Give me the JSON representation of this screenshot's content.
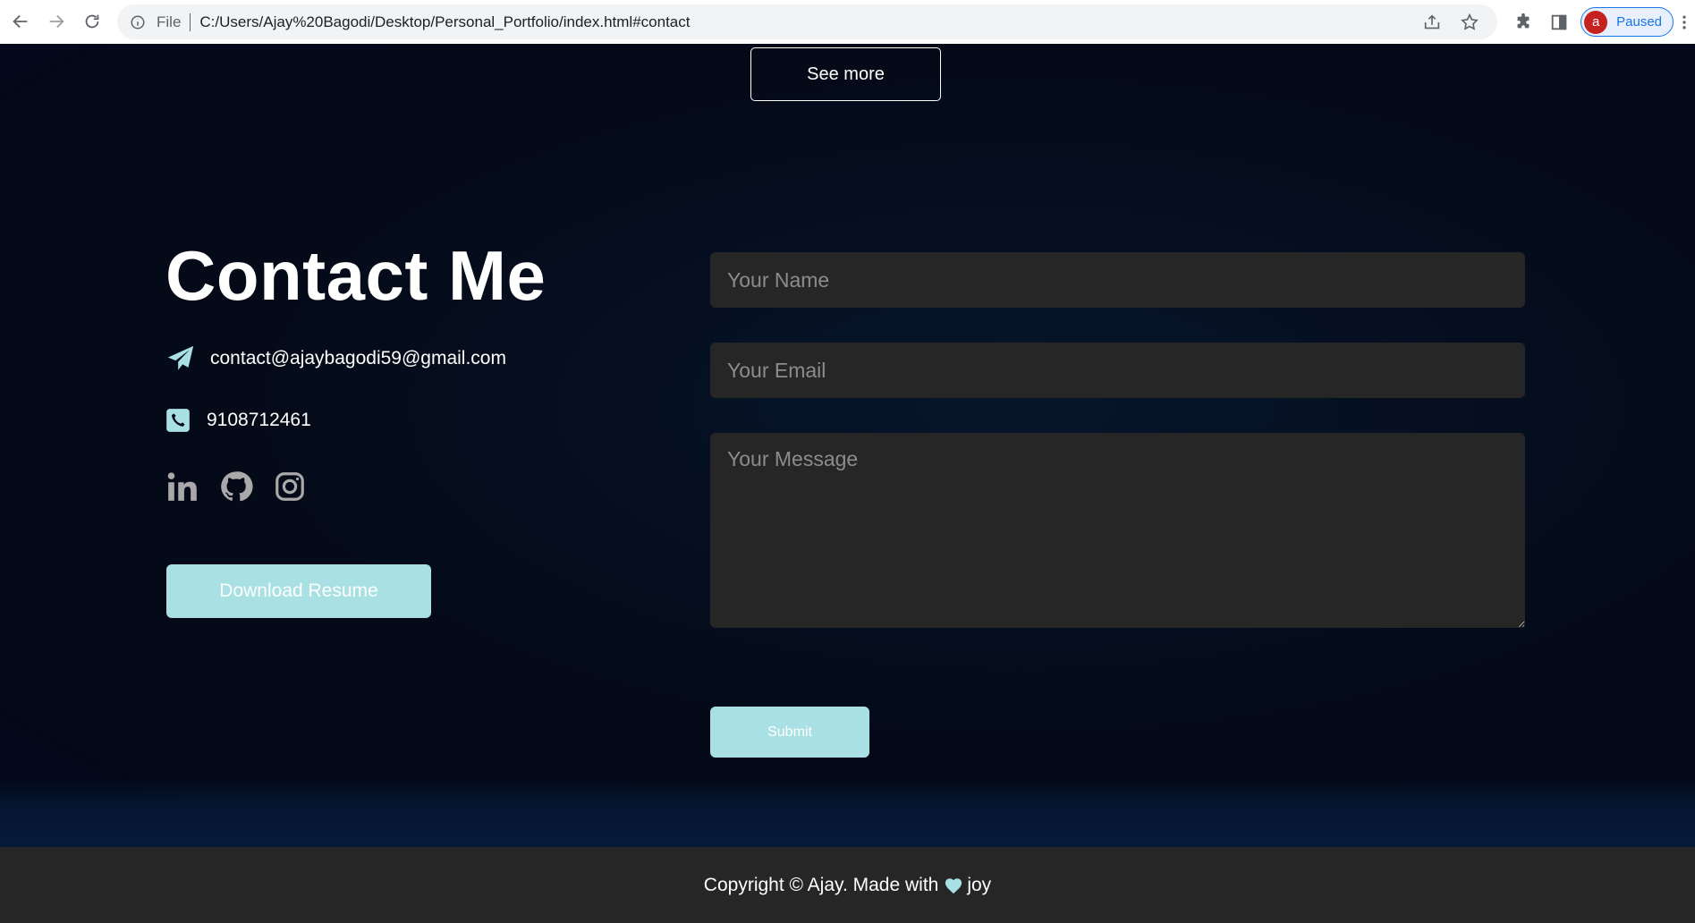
{
  "browser": {
    "scheme": "File",
    "url": "C:/Users/Ajay%20Bagodi/Desktop/Personal_Portfolio/index.html#contact",
    "profile_initial": "a",
    "profile_status": "Paused"
  },
  "projects": {
    "see_more_label": "See more"
  },
  "contact": {
    "title": "Contact Me",
    "email": "contact@ajaybagodi59@gmail.com",
    "phone": "9108712461",
    "socials": [
      "linkedin-icon",
      "github-icon",
      "instagram-icon"
    ],
    "download_label": "Download Resume"
  },
  "form": {
    "name_placeholder": "Your Name",
    "email_placeholder": "Your Email",
    "message_placeholder": "Your Message",
    "submit_label": "Submit"
  },
  "footer": {
    "prefix": "Copyright © Ajay. Made with",
    "suffix": "joy"
  },
  "colors": {
    "accent": "#a8e0e3",
    "input_bg": "#262626",
    "page_bg": "#040a18",
    "footer_bg": "#262626"
  }
}
